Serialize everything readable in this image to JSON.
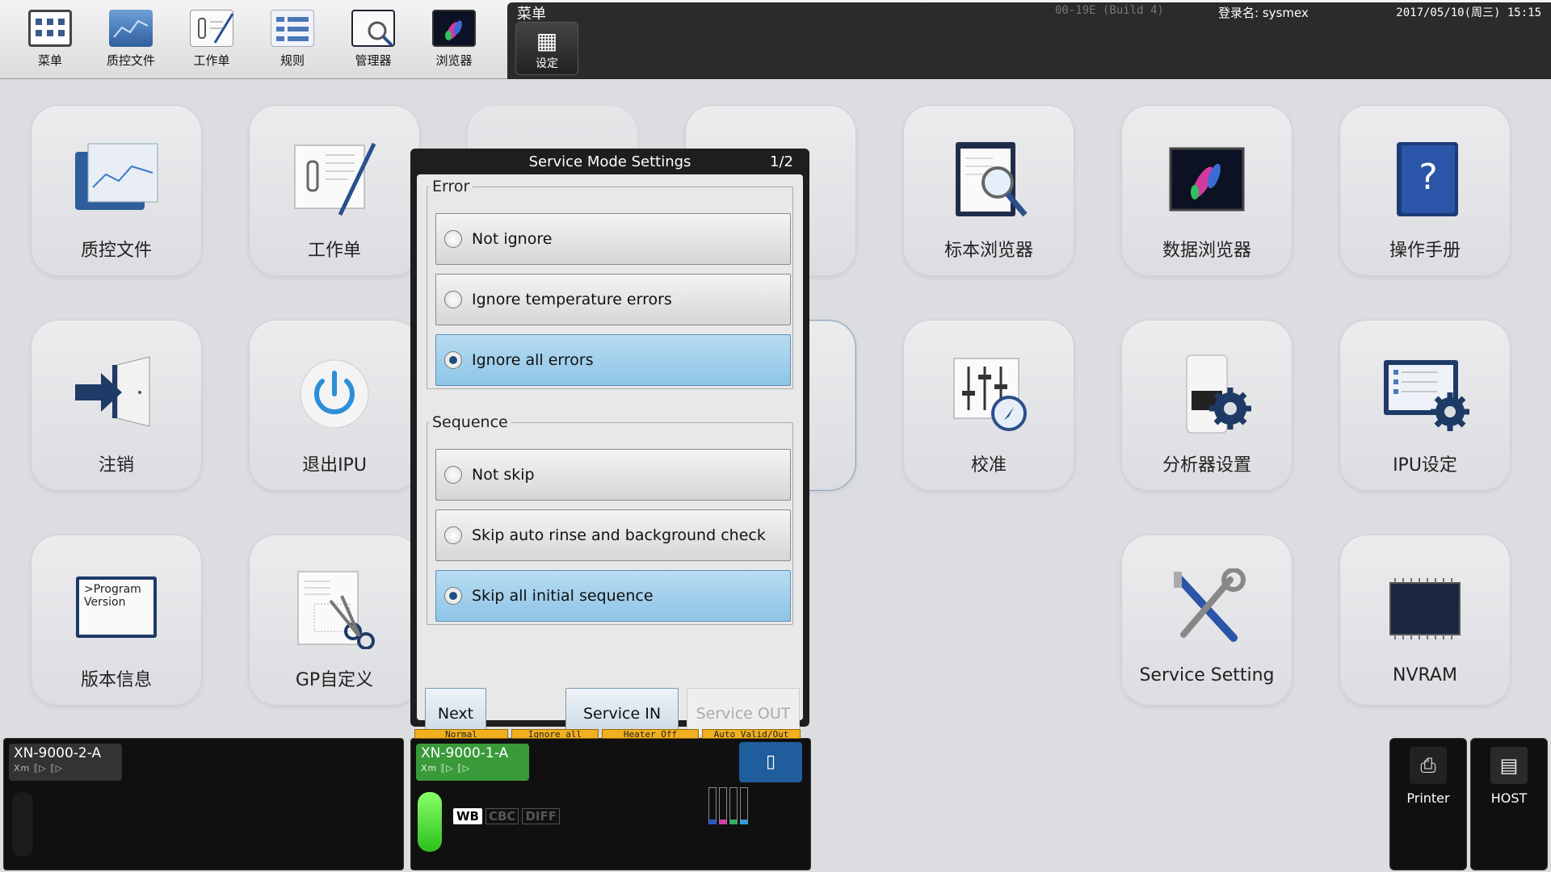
{
  "toolbar": {
    "items": [
      {
        "label": "菜单",
        "icon": "menu-grid-icon"
      },
      {
        "label": "质控文件",
        "icon": "qc-file-icon"
      },
      {
        "label": "工作单",
        "icon": "worklist-icon"
      },
      {
        "label": "规则",
        "icon": "rules-icon"
      },
      {
        "label": "管理器",
        "icon": "manager-icon"
      },
      {
        "label": "浏览器",
        "icon": "browser-icon"
      }
    ],
    "menu_title": "菜单",
    "settings_label": "设定",
    "build": "00-19E (Build 4)",
    "login": "登录名: sysmex",
    "datetime": "2017/05/10(周三) 15:15"
  },
  "tiles": [
    {
      "label": "质控文件",
      "icon": "qc-file-icon"
    },
    {
      "label": "工作单",
      "icon": "worklist-icon"
    },
    {
      "label": "标本浏览器",
      "icon": "sample-browser-icon"
    },
    {
      "label": "数据浏览器",
      "icon": "data-browser-icon"
    },
    {
      "label": "操作手册",
      "icon": "manual-icon"
    },
    {
      "label": "注销",
      "icon": "logout-icon"
    },
    {
      "label": "退出IPU",
      "icon": "power-icon"
    },
    {
      "label": "校准",
      "icon": "calibration-icon"
    },
    {
      "label": "分析器设置",
      "icon": "analyzer-settings-icon"
    },
    {
      "label": "IPU设定",
      "icon": "ipu-settings-icon"
    },
    {
      "label": "版本信息",
      "icon": "version-icon",
      "icon_text": ">Program Version"
    },
    {
      "label": "GP自定义",
      "icon": "gp-custom-icon"
    },
    {
      "label": "Service Setting",
      "icon": "service-tools-icon"
    },
    {
      "label": "NVRAM",
      "icon": "nvram-chip-icon"
    }
  ],
  "dialog": {
    "title": "Service Mode Settings",
    "page": "1/2",
    "error_group": {
      "legend": "Error",
      "options": [
        "Not ignore",
        "Ignore temperature errors",
        "Ignore all errors"
      ],
      "selected": "Ignore all errors"
    },
    "sequence_group": {
      "legend": "Sequence",
      "options": [
        "Not skip",
        "Skip auto rinse and background check",
        "Skip all initial sequence"
      ],
      "selected": "Skip all initial sequence"
    },
    "next_label": "Next",
    "service_in_label": "Service IN",
    "service_out_label": "Service OUT"
  },
  "bottom": {
    "analyzer_1": {
      "name": "XN-9000-2-A",
      "sub": "Xm  ⟦▷  ⟦▷"
    },
    "analyzer_2": {
      "name": "XN-9000-1-A",
      "sub": "Xm  ⟦▷  ⟦▷",
      "warn_labels": [
        "Normal",
        "Ignore all",
        "Heater Off",
        "Auto Valid/Out"
      ]
    },
    "modes": [
      "WB",
      "CBC",
      "DIFF"
    ],
    "printer_label": "Printer",
    "host_label": "HOST"
  }
}
